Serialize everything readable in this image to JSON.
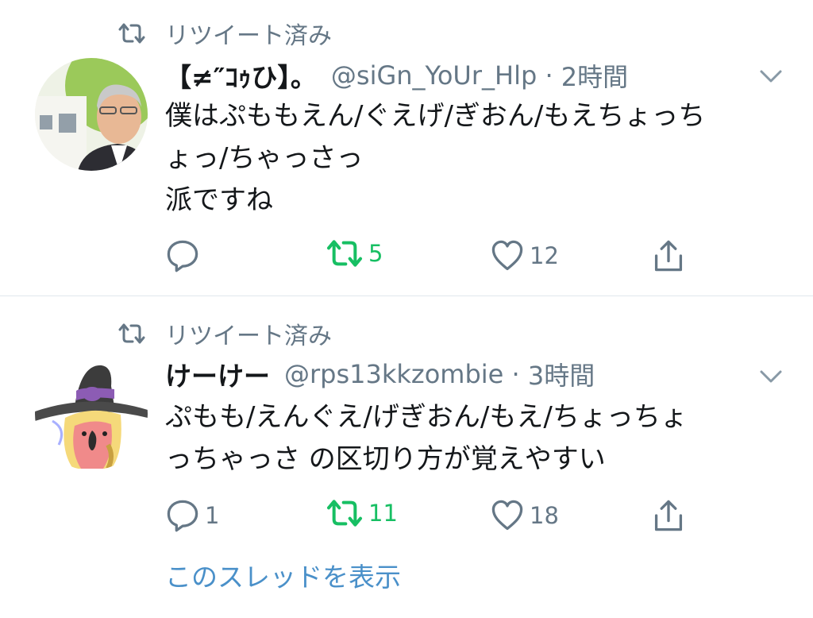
{
  "tweets": [
    {
      "retweet_label": "リツイート済み",
      "name": "【≠″ｺｩひ】。",
      "handle": "@siGn_YoUr_Hlp",
      "time": "2時間",
      "text_lines": [
        "僕はぷももえん/ぐえげ/ぎおん/もえちょっち",
        "ょっ/ちゃっさっ",
        "派ですね"
      ],
      "actions": {
        "reply": "",
        "retweet": "5",
        "like": "12"
      }
    },
    {
      "retweet_label": "リツイート済み",
      "name": "けーけー",
      "handle": "@rps13kkzombie",
      "time": "3時間",
      "text_lines": [
        "ぷもも/えんぐえ/げぎおん/もえ/ちょっちょ",
        "っちゃっさ の区切り方が覚えやすい"
      ],
      "actions": {
        "reply": "1",
        "retweet": "11",
        "like": "18"
      }
    }
  ],
  "thread_link": "このスレッドを表示",
  "colors": {
    "retweet_active": "#17bf63",
    "secondary_text": "#657786",
    "link": "#4a90c9",
    "divider": "#e1e8ed"
  },
  "icons": [
    "retweet-icon",
    "chevron-down-icon",
    "reply-icon",
    "like-icon",
    "share-icon"
  ]
}
